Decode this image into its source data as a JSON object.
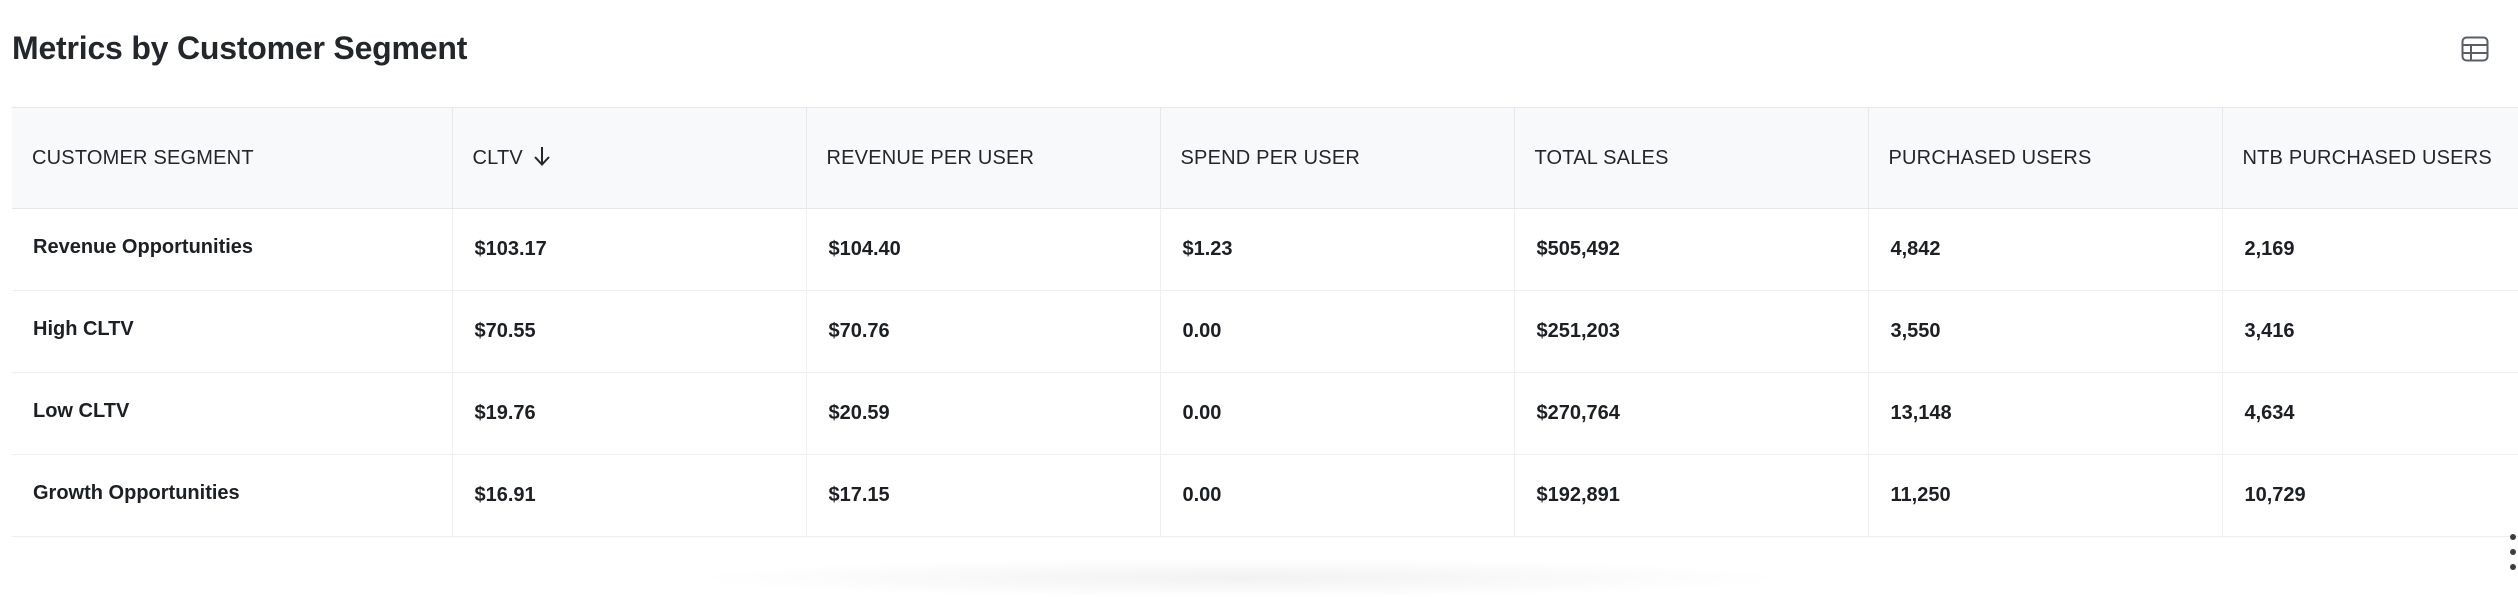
{
  "panel": {
    "title": "Metrics by Customer Segment",
    "view_toggle_icon": "table-icon"
  },
  "table": {
    "sorted_column": "CLTV",
    "sort_direction": "descending",
    "columns": [
      "CUSTOMER SEGMENT",
      "CLTV",
      "REVENUE PER USER",
      "SPEND PER USER",
      "TOTAL SALES",
      "PURCHASED USERS",
      "NTB PURCHASED USERS"
    ],
    "rows": [
      [
        "Revenue Opportunities",
        "$103.17",
        "$104.40",
        "$1.23",
        "$505,492",
        "4,842",
        "2,169"
      ],
      [
        "High CLTV",
        "$70.55",
        "$70.76",
        "0.00",
        "$251,203",
        "3,550",
        "3,416"
      ],
      [
        "Low CLTV",
        "$19.76",
        "$20.59",
        "0.00",
        "$270,764",
        "13,148",
        "4,634"
      ],
      [
        "Growth Opportunities",
        "$16.91",
        "$17.15",
        "0.00",
        "$192,891",
        "11,250",
        "10,729"
      ]
    ]
  },
  "icons": {
    "sort": "arrow-down-icon",
    "more": "kebab-menu-icon"
  },
  "colors": {
    "header_bg": "#f8f9fb",
    "border": "#e6e8eb",
    "text": "#1c1f23"
  }
}
